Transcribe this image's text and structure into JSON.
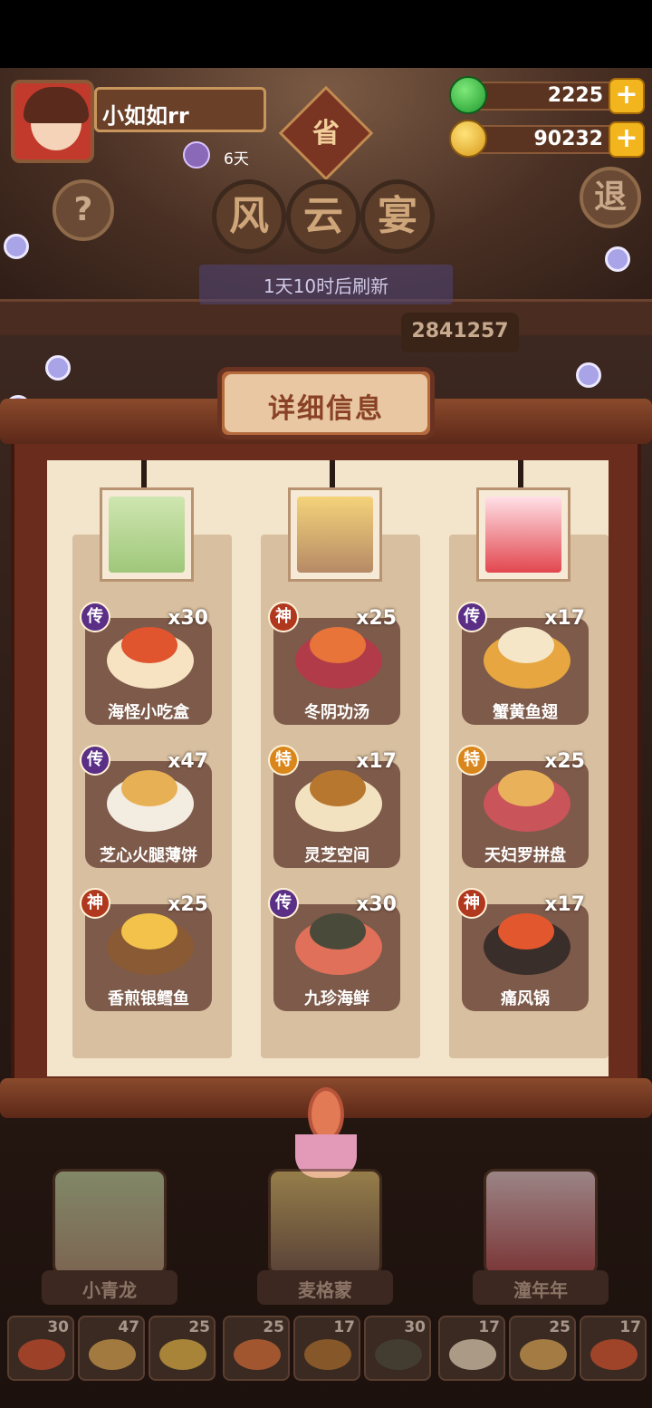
{
  "player": {
    "name": "小如如rr",
    "streak": "6天"
  },
  "currency": {
    "jade": "2225",
    "coins": "90232",
    "plus_symbol": "+"
  },
  "nav": {
    "help_symbol": "?",
    "exit_label": "退",
    "province_label": "省"
  },
  "event": {
    "title_chars": [
      "风",
      "云",
      "宴"
    ],
    "refresh_text": "1天10时后刷新",
    "score": "2841257"
  },
  "panel": {
    "title": "详细信息"
  },
  "columns": [
    {
      "character": "小青龙",
      "dishes": [
        {
          "name": "海怪小吃盒",
          "count": "x30",
          "grade": "传"
        },
        {
          "name": "芝心火腿薄饼",
          "count": "x47",
          "grade": "传"
        },
        {
          "name": "香煎银鳕鱼",
          "count": "x25",
          "grade": "神"
        }
      ]
    },
    {
      "character": "麦格蒙",
      "dishes": [
        {
          "name": "冬阴功汤",
          "count": "x25",
          "grade": "神"
        },
        {
          "name": "灵芝空间",
          "count": "x17",
          "grade": "特"
        },
        {
          "name": "九珍海鲜",
          "count": "x30",
          "grade": "传"
        }
      ]
    },
    {
      "character": "潼年年",
      "dishes": [
        {
          "name": "蟹黄鱼翅",
          "count": "x17",
          "grade": "传"
        },
        {
          "name": "天妇罗拼盘",
          "count": "x25",
          "grade": "特"
        },
        {
          "name": "痛风锅",
          "count": "x17",
          "grade": "神"
        }
      ]
    }
  ],
  "slots": [
    "30",
    "47",
    "25",
    "25",
    "17",
    "30",
    "17",
    "25",
    "17"
  ],
  "colors": {
    "grade_chuan": "#5b2f86",
    "grade_shen": "#b0381e",
    "grade_te": "#d9861c"
  }
}
